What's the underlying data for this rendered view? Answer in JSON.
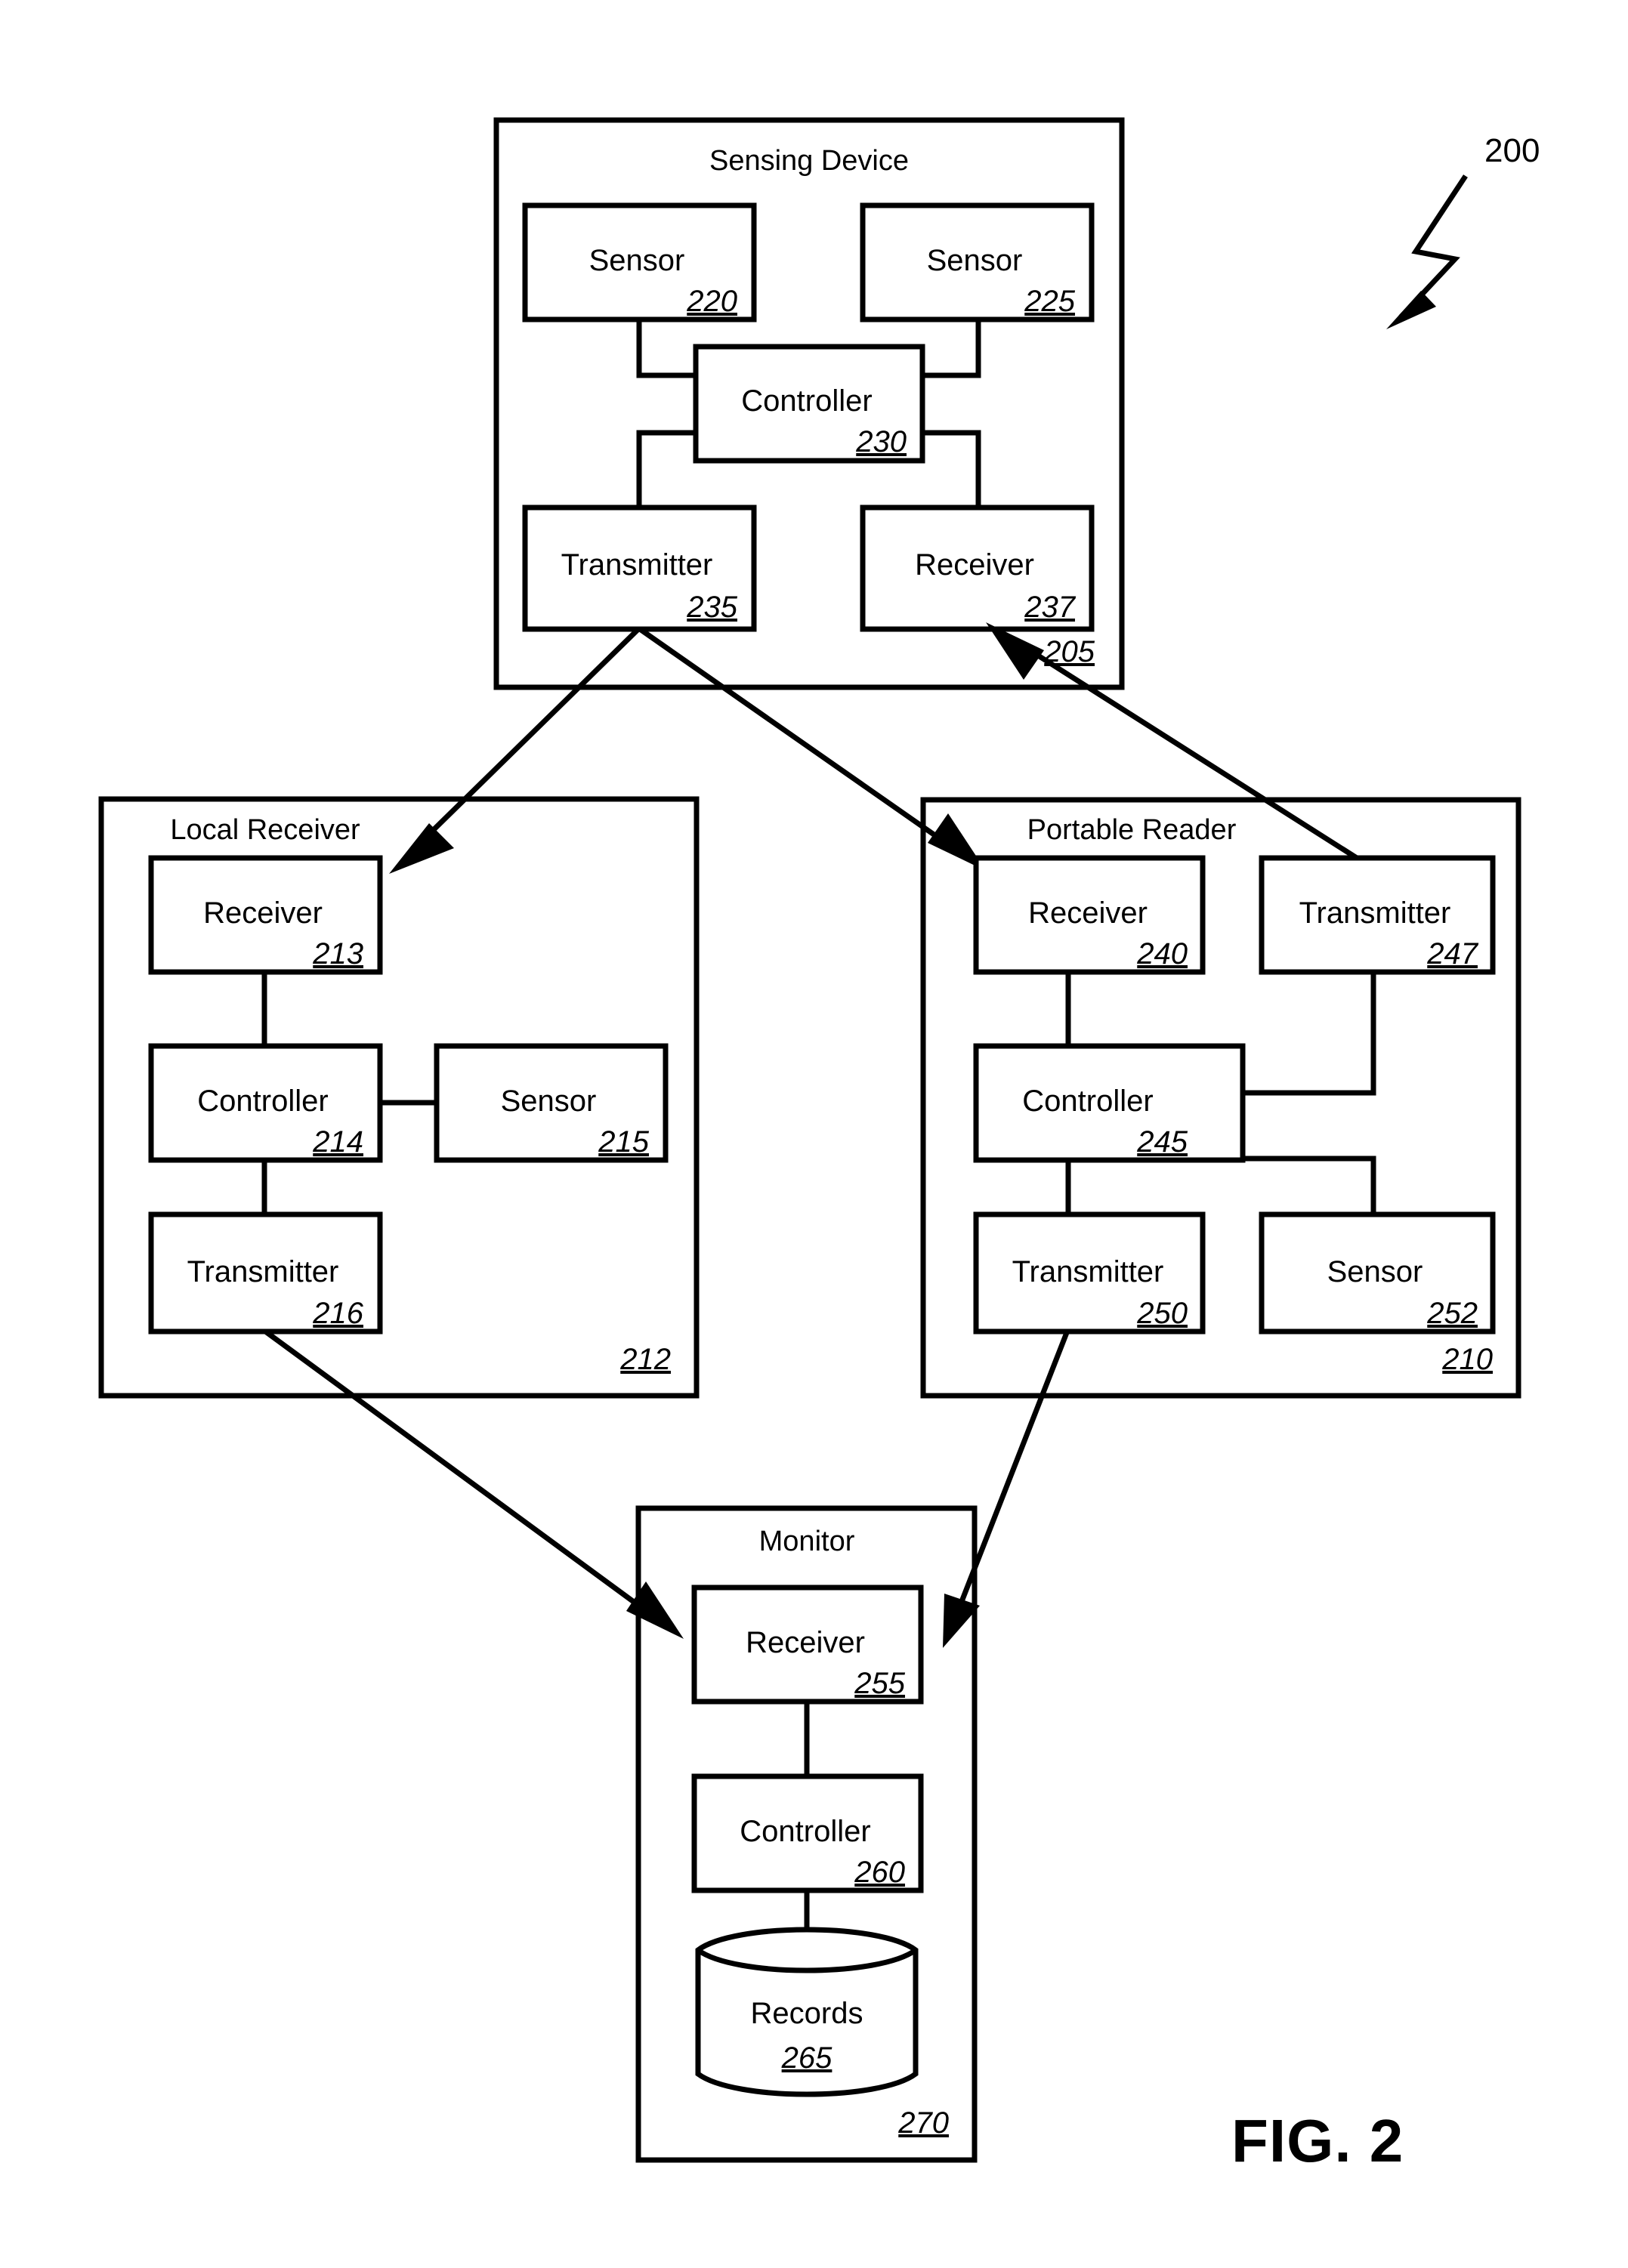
{
  "figure": {
    "caption": "FIG. 2",
    "system_ref": "200"
  },
  "groups": {
    "sensing_device": {
      "title": "Sensing Device",
      "ref": "205",
      "nodes": {
        "sensor_a": {
          "label": "Sensor",
          "ref": "220"
        },
        "sensor_b": {
          "label": "Sensor",
          "ref": "225"
        },
        "controller": {
          "label": "Controller",
          "ref": "230"
        },
        "transmitter": {
          "label": "Transmitter",
          "ref": "235"
        },
        "receiver": {
          "label": "Receiver",
          "ref": "237"
        }
      }
    },
    "local_receiver": {
      "title": "Local Receiver",
      "ref": "212",
      "nodes": {
        "receiver": {
          "label": "Receiver",
          "ref": "213"
        },
        "controller": {
          "label": "Controller",
          "ref": "214"
        },
        "sensor": {
          "label": "Sensor",
          "ref": "215"
        },
        "transmitter": {
          "label": "Transmitter",
          "ref": "216"
        }
      }
    },
    "portable_reader": {
      "title": "Portable Reader",
      "ref": "210",
      "nodes": {
        "receiver": {
          "label": "Receiver",
          "ref": "240"
        },
        "transmitter_top": {
          "label": "Transmitter",
          "ref": "247"
        },
        "controller": {
          "label": "Controller",
          "ref": "245"
        },
        "transmitter_bottom": {
          "label": "Transmitter",
          "ref": "250"
        },
        "sensor": {
          "label": "Sensor",
          "ref": "252"
        }
      }
    },
    "monitor": {
      "title": "Monitor",
      "ref": "270",
      "nodes": {
        "receiver": {
          "label": "Receiver",
          "ref": "255"
        },
        "controller": {
          "label": "Controller",
          "ref": "260"
        },
        "records": {
          "label": "Records",
          "ref": "265"
        }
      }
    }
  }
}
